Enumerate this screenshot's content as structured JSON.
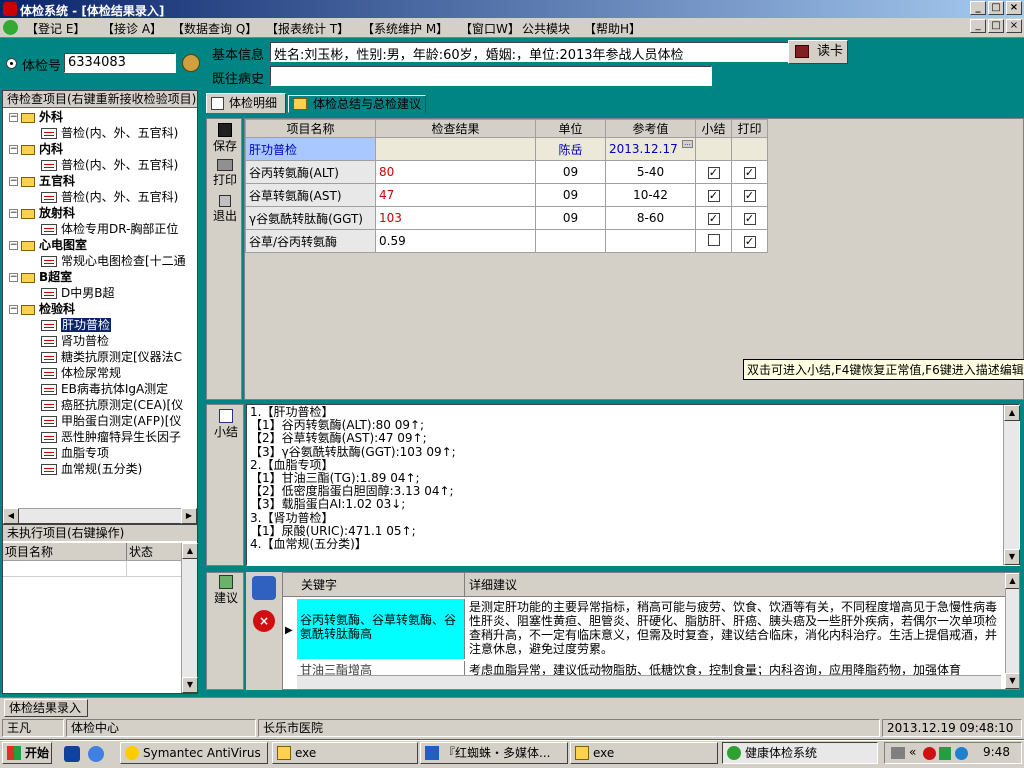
{
  "title": "体检系统 - [体检结果录入]",
  "menu": [
    "【登记 E】",
    "【接诊 A】",
    "【数据查询 Q】",
    "【报表统计 T】",
    "【系统维护 M】",
    "【窗口W】",
    "公共模块",
    "【帮助H】"
  ],
  "top": {
    "exam_label": "体检号",
    "exam_value": "6334083",
    "basic_label": "基本信息",
    "basic_value": "姓名:刘玉彬，性别:男，年龄:60岁，婚姻:，单位:2013年参战人员体检",
    "history_label": "既往病史",
    "history_value": "",
    "read_card": "读卡"
  },
  "tree": {
    "header": "待检查项目(右键重新接收检验项目)",
    "rows": [
      {
        "kind": "dept",
        "label": "外科"
      },
      {
        "kind": "item",
        "label": "普检(内、外、五官科)"
      },
      {
        "kind": "dept",
        "label": "内科"
      },
      {
        "kind": "item",
        "label": "普检(内、外、五官科)"
      },
      {
        "kind": "dept",
        "label": "五官科"
      },
      {
        "kind": "item",
        "label": "普检(内、外、五官科)"
      },
      {
        "kind": "dept",
        "label": "放射科"
      },
      {
        "kind": "item",
        "label": "体检专用DR-胸部正位"
      },
      {
        "kind": "dept",
        "label": "心电图室"
      },
      {
        "kind": "item",
        "label": "常规心电图检查[十二通"
      },
      {
        "kind": "dept",
        "label": "B超室"
      },
      {
        "kind": "item",
        "label": "D中男B超"
      },
      {
        "kind": "dept",
        "label": "检验科"
      },
      {
        "kind": "sel",
        "label": "肝功普检"
      },
      {
        "kind": "item",
        "label": "肾功普检"
      },
      {
        "kind": "item",
        "label": "糖类抗原测定[仪器法C"
      },
      {
        "kind": "item",
        "label": "体检尿常规"
      },
      {
        "kind": "item",
        "label": "EB病毒抗体IgA测定"
      },
      {
        "kind": "item",
        "label": "癌胚抗原测定(CEA)[仪"
      },
      {
        "kind": "item",
        "label": "甲胎蛋白测定(AFP)[仪"
      },
      {
        "kind": "item",
        "label": "恶性肿瘤特异生长因子"
      },
      {
        "kind": "item",
        "label": "血脂专项"
      },
      {
        "kind": "item",
        "label": "血常规(五分类)"
      }
    ]
  },
  "pending": {
    "header": "未执行项目(右键操作)",
    "col_name": "项目名称",
    "col_status": "状态"
  },
  "tabs": {
    "detail": "体检明细",
    "summary": "体检总结与总检建议"
  },
  "side_buttons": {
    "save": "保存",
    "print": "打印",
    "exit": "退出",
    "summary": "小结",
    "advice": "建议"
  },
  "results": {
    "headers": [
      "项目名称",
      "检查结果",
      "单位",
      "参考值",
      "小结",
      "打印"
    ],
    "group": {
      "name": "肝功普检",
      "doctor": "陈岳",
      "date": "2013.12.17"
    },
    "rows": [
      {
        "name": "谷丙转氨酶(ALT)",
        "result": "80",
        "unit": "09",
        "ref": "5-40",
        "summary": true,
        "print": true,
        "abnormal": true
      },
      {
        "name": "谷草转氨酶(AST)",
        "result": "47",
        "unit": "09",
        "ref": "10-42",
        "summary": true,
        "print": true,
        "abnormal": true
      },
      {
        "name": "γ谷氨酰转肽酶(GGT)",
        "result": "103",
        "unit": "09",
        "ref": "8-60",
        "summary": true,
        "print": true,
        "abnormal": true
      },
      {
        "name": "谷草/谷丙转氨酶",
        "result": "0.59",
        "unit": "",
        "ref": "",
        "summary": false,
        "print": true,
        "abnormal": false
      }
    ],
    "hint": "双击可进入小结,F4键恢复正常值,F6键进入描述编辑"
  },
  "summary_lines": [
    "1.【肝功普检】",
    "【1】谷丙转氨酶(ALT):80 09↑;",
    "【2】谷草转氨酶(AST):47 09↑;",
    "【3】γ谷氨酰转肽酶(GGT):103 09↑;",
    "2.【血脂专项】",
    "【1】甘油三酯(TG):1.89 04↑;",
    "【2】低密度脂蛋白胆固醇:3.13 04↑;",
    "【3】载脂蛋白AI:1.02 03↓;",
    "3.【肾功普检】",
    "【1】尿酸(URIC):471.1 05↑;",
    "4.【血常规(五分类)】"
  ],
  "advice": {
    "col_keyword": "关键字",
    "col_detail": "详细建议",
    "row1_keyword": "谷丙转氨酶、谷草转氨酶、谷氨酰转肽酶高",
    "row1_detail": "是测定肝功能的主要异常指标，稍高可能与疲劳、饮食、饮酒等有关，不同程度增高见于急慢性病毒性肝炎、阻塞性黄疸、胆管炎、肝硬化、脂肪肝、肝癌、胰头癌及一些肝外疾病，若偶尔一次单项检查稍升高，不一定有临床意义，但需及时复查，建议结合临床，消化内科治疗。生活上提倡戒酒，并注意休息，避免过度劳累。",
    "row2_keyword": "甘油三酯增高",
    "row2_detail": "考虑血脂异常，建议低动物脂肪、低糖饮食，控制食量；内科咨询，应用降脂药物，加强体育"
  },
  "window_tab": "体检结果录入",
  "status": {
    "user": "王凡",
    "center": "体检中心",
    "hospital": "长乐市医院",
    "datetime": "2013.12.19 09:48:10"
  },
  "taskbar": {
    "start": "开始",
    "tasks": [
      "Symantec AntiVirus",
      "exe",
      "『红蜘蛛・多媒体...",
      "exe",
      "健康体检系统"
    ],
    "clock": "9:48"
  }
}
